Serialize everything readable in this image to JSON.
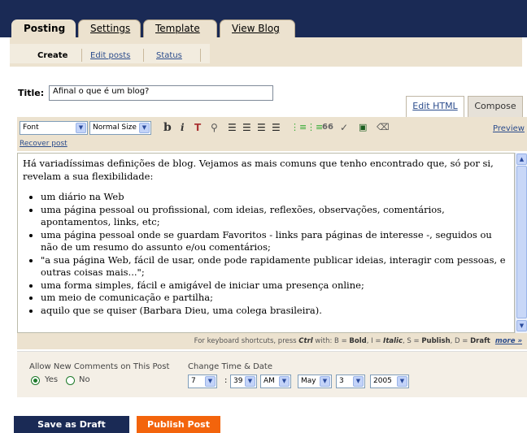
{
  "tabs": [
    "Posting",
    "Settings",
    "Template",
    "View Blog"
  ],
  "subnav": [
    "Create",
    "Edit posts",
    "Status"
  ],
  "title": {
    "label": "Title:",
    "value": "Afinal o que é um blog?"
  },
  "modes": {
    "html": "Edit HTML",
    "compose": "Compose"
  },
  "toolbar": {
    "font": "Font",
    "size": "Normal Size",
    "bold": "b",
    "italic": "i",
    "text_color": "T",
    "link": "⚲",
    "quote": "66",
    "spell": "✓",
    "preview": "Preview"
  },
  "recover_post": "Recover post",
  "editor": {
    "intro": "Há variadíssimas definições de blog. Vejamos as mais comuns que tenho encontrado que, só por si, revelam a sua flexibilidade:",
    "items": [
      "um diário na Web",
      "uma página pessoal ou profissional, com ideias, reflexões, observações, comentários, apontamentos, links, etc;",
      "uma página pessoal onde se guardam Favoritos - links para páginas de interesse -, seguidos ou não de um resumo do assunto e/ou comentários;",
      "\"a sua página Web, fácil de usar, onde pode rapidamente publicar ideias, interagir com pessoas, e outras coisas mais...\";",
      "uma forma simples, fácil e amigável de iniciar uma presença online;",
      "um meio de comunicação e partilha;",
      "aquilo que se quiser (Barbara Dieu, uma colega brasileira)."
    ]
  },
  "shortcuts": {
    "prefix": "For keyboard shortcuts, press ",
    "key": "Ctrl",
    "middle": " with: ",
    "b": "B = ",
    "b_val": "Bold",
    "i": ", I = ",
    "i_val": "Italic",
    "s": ", S = ",
    "s_val": "Publish",
    "d": ", D = ",
    "d_val": "Draft",
    "more": "more »"
  },
  "comments": {
    "label": "Allow New Comments on This Post",
    "yes": "Yes",
    "no": "No"
  },
  "datetime": {
    "label": "Change Time & Date",
    "hour": "7",
    "minute": "39",
    "ampm": "AM",
    "month": "May",
    "day": "3",
    "year": "2005"
  },
  "buttons": {
    "draft": "Save as Draft",
    "publish": "Publish Post"
  },
  "colors": {
    "nav": "#1a2a55",
    "tan": "#ece2cf",
    "publish": "#f3640c"
  }
}
